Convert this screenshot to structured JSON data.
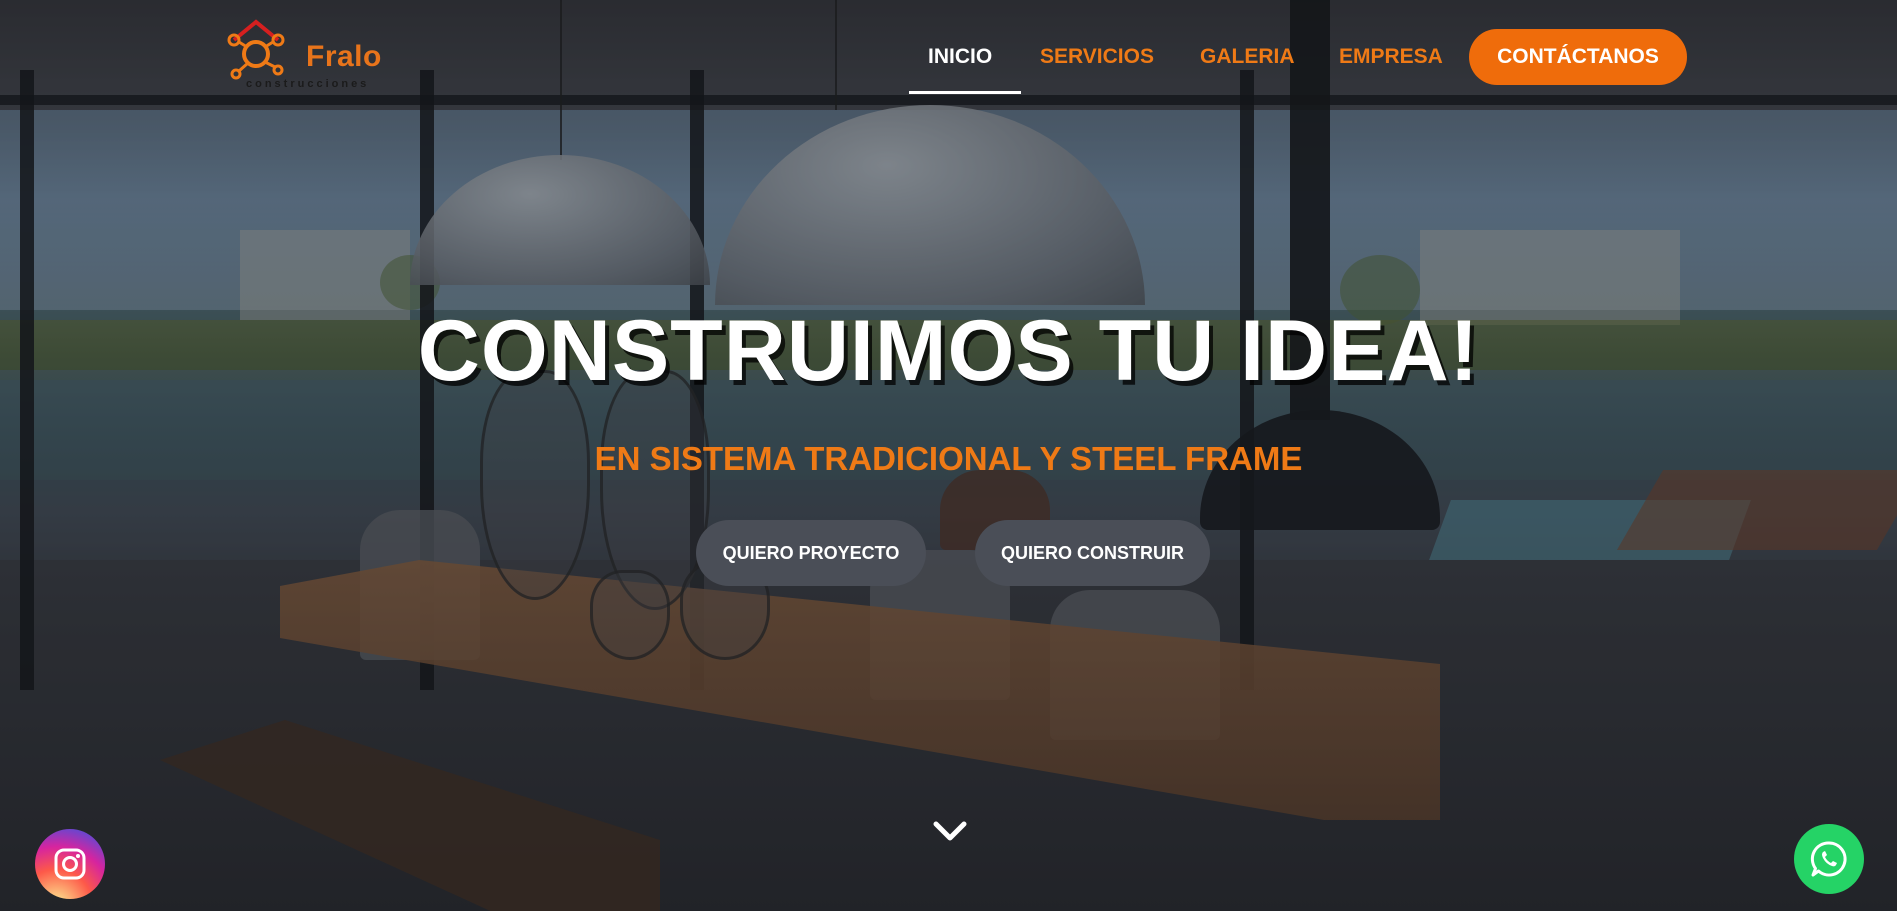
{
  "brand": {
    "name": "Fralo",
    "subtitle": "construcciones",
    "accent": "#ef7a16",
    "cta_color": "#ef6c0b"
  },
  "nav": {
    "items": [
      {
        "label": "INICIO",
        "active": true
      },
      {
        "label": "SERVICIOS",
        "active": false
      },
      {
        "label": "GALERIA",
        "active": false
      },
      {
        "label": "EMPRESA",
        "active": false
      }
    ],
    "cta": "CONTÁCTANOS"
  },
  "hero": {
    "headline": "CONSTRUIMOS TU IDEA!",
    "subheadline": "EN SISTEMA TRADICIONAL Y STEEL FRAME",
    "buttons": [
      {
        "label": "QUIERO PROYECTO"
      },
      {
        "label": "QUIERO CONSTRUIR"
      }
    ],
    "scroll_icon": "chevron-down-icon"
  },
  "floating": {
    "left_icon": "instagram-icon",
    "right_icon": "whatsapp-icon"
  }
}
